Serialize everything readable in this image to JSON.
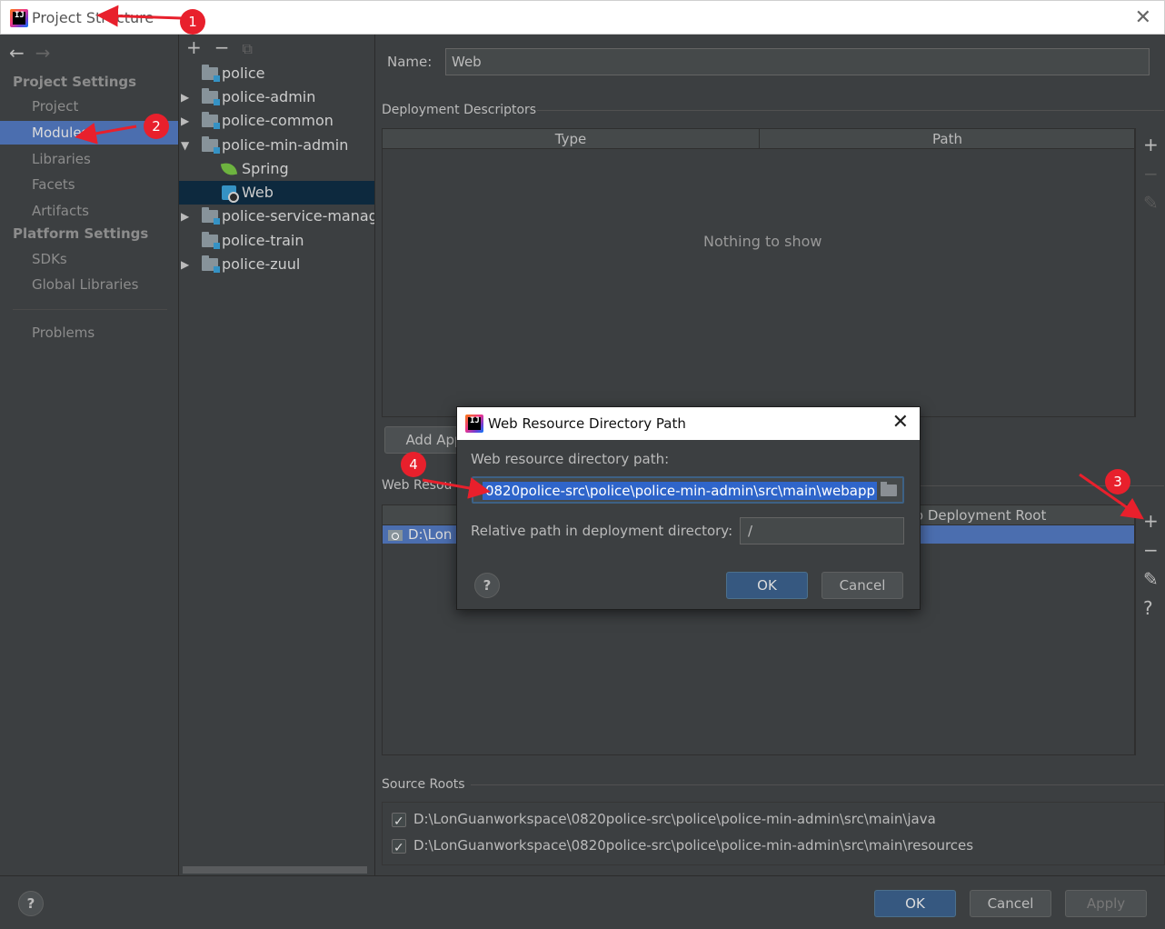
{
  "window": {
    "title": "Project Structure",
    "close_glyph": "✕"
  },
  "left_nav": {
    "back_glyph": "←",
    "forward_glyph": "→",
    "project_settings_heading": "Project Settings",
    "platform_settings_heading": "Platform Settings",
    "items": {
      "project": "Project",
      "modules": "Modules",
      "libraries": "Libraries",
      "facets": "Facets",
      "artifacts": "Artifacts",
      "sdks": "SDKs",
      "global_libraries": "Global Libraries",
      "problems": "Problems"
    },
    "selected": "modules"
  },
  "tree": {
    "toolbar": {
      "add": "+",
      "remove": "−",
      "copy": "⧉"
    },
    "rows": {
      "police": "police",
      "police_admin": "police-admin",
      "police_common": "police-common",
      "police_min_admin": "police-min-admin",
      "spring": "Spring",
      "web": "Web",
      "police_service_manager": "police-service-manager",
      "police_train": "police-train",
      "police_zuul": "police-zuul"
    },
    "expand_glyph": "▶",
    "collapse_glyph": "▼",
    "selected": "web"
  },
  "facet": {
    "name_label": "Name:",
    "name_value": "Web",
    "deployment_descriptors_title": "Deployment Descriptors",
    "dd_columns": [
      "Type",
      "Path"
    ],
    "dd_empty": "Nothing to show",
    "add_app_button": "Add App",
    "web_resources_title": "Web Resou",
    "wr_column_right": "to Deployment Root",
    "wr_row_path": "D:\\Lon",
    "source_roots_title": "Source Roots",
    "source_roots": [
      "D:\\LonGuanworkspace\\0820police-src\\police\\police-min-admin\\src\\main\\java",
      "D:\\LonGuanworkspace\\0820police-src\\police\\police-min-admin\\src\\main\\resources"
    ],
    "side_tool_glyphs": {
      "add": "+",
      "remove": "−",
      "edit": "✎",
      "help": "?"
    }
  },
  "footer": {
    "help": "?",
    "ok": "OK",
    "cancel": "Cancel",
    "apply": "Apply"
  },
  "dialog": {
    "title": "Web Resource Directory Path",
    "close_glyph": "✕",
    "path_label": "Web resource directory path:",
    "path_value": "0820police-src\\police\\police-min-admin\\src\\main\\webapp",
    "relative_label": "Relative path in deployment directory:",
    "relative_value": "/",
    "help": "?",
    "ok": "OK",
    "cancel": "Cancel"
  },
  "annotations": {
    "markers": [
      "1",
      "2",
      "3",
      "4"
    ],
    "color": "#e8202c"
  },
  "colors": {
    "background": "#3c3f41",
    "selection": "#4b6eaf",
    "tree_selection": "#0d293e",
    "primary_button": "#365880",
    "text_selection": "#2f65ca"
  }
}
